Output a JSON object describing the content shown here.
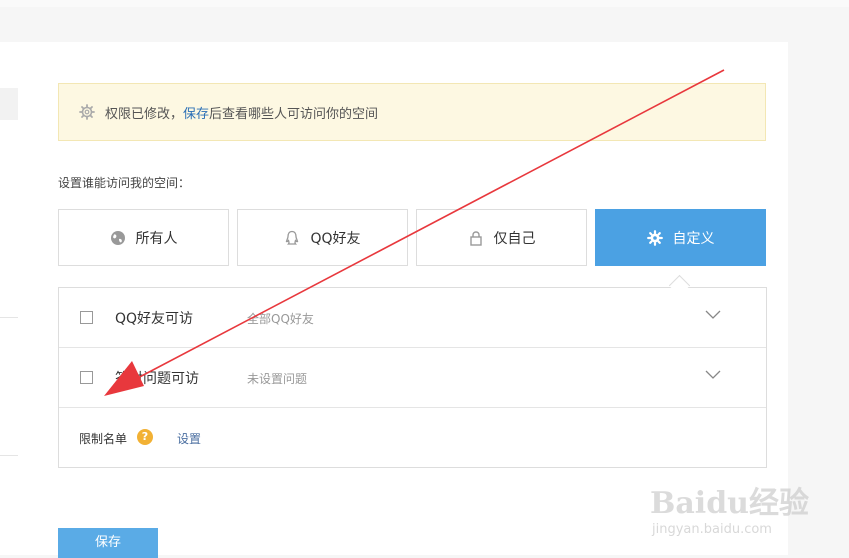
{
  "notice": {
    "text_before": "权限已修改，",
    "link": "保存",
    "text_after": "后查看哪些人可访问你的空间"
  },
  "section_label": "设置谁能访问我的空间：",
  "options": [
    {
      "label": "所有人",
      "icon": "globe-icon"
    },
    {
      "label": "QQ好友",
      "icon": "qq-icon"
    },
    {
      "label": "仅自己",
      "icon": "lock-icon"
    },
    {
      "label": "自定义",
      "icon": "gear-icon",
      "active": true
    }
  ],
  "custom": {
    "rows": [
      {
        "title": "QQ好友可访",
        "desc": "全部QQ好友"
      },
      {
        "title": "答对问题可访",
        "desc": "未设置问题"
      }
    ],
    "limit_label": "限制名单",
    "help_symbol": "?",
    "set_link": "设置"
  },
  "save_button": "保存",
  "watermark": {
    "logo": "Baidu经验",
    "url": "jingyan.baidu.com"
  },
  "colors": {
    "accent": "#4ba1e3",
    "arrow": "#e8383d",
    "notice_bg": "#fdf8e2"
  }
}
